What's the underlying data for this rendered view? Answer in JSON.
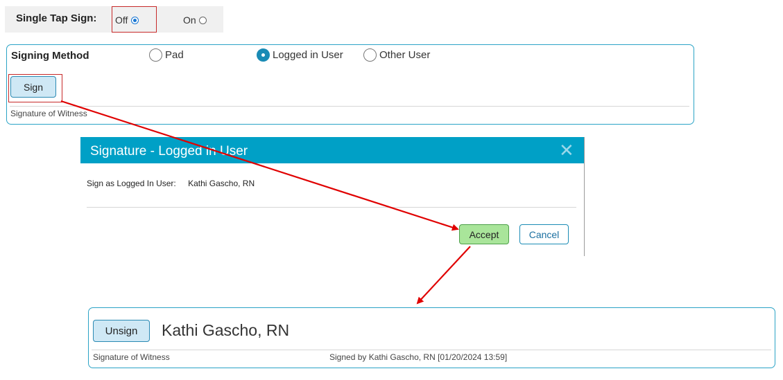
{
  "single_tap": {
    "label": "Single Tap Sign:",
    "off_label": "Off",
    "on_label": "On",
    "selected": "Off"
  },
  "signing_panel": {
    "method_label": "Signing Method",
    "options": [
      {
        "label": "Pad",
        "selected": false
      },
      {
        "label": "Logged in User",
        "selected": true
      },
      {
        "label": "Other User",
        "selected": false
      }
    ],
    "sign_button": "Sign",
    "footer_label": "Signature of Witness"
  },
  "dialog": {
    "title": "Signature - Logged in User",
    "close_icon": "close-icon",
    "sign_as_label": "Sign as Logged In User:",
    "sign_as_value": "Kathi Gascho, RN",
    "accept_button": "Accept",
    "cancel_button": "Cancel"
  },
  "signed_panel": {
    "unsign_button": "Unsign",
    "signer_name": "Kathi Gascho, RN",
    "footer_label": "Signature of Witness",
    "signed_by_text": "Signed by Kathi Gascho, RN [01/20/2024 13:59]"
  },
  "colors": {
    "accent": "#00a0c6",
    "panel_border": "#2aa3c6",
    "highlight_box": "#c62828",
    "annotation_arrow": "#e00000",
    "accept_bg": "#a9e59a"
  }
}
